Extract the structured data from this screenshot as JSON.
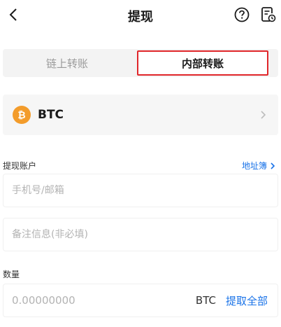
{
  "header": {
    "title": "提现",
    "back_icon": "chevron-left-icon",
    "help_icon": "question-circle-icon",
    "record_icon": "document-clock-icon"
  },
  "tabs": [
    {
      "label": "链上转账",
      "active": false
    },
    {
      "label": "内部转账",
      "active": true
    }
  ],
  "coin": {
    "name": "BTC",
    "icon": "bitcoin-icon",
    "icon_color": "#f39c2b"
  },
  "account": {
    "label": "提现账户",
    "address_book": "地址簿",
    "phone_placeholder": "手机号/邮箱",
    "remark_placeholder": "备注信息(非必填)"
  },
  "amount": {
    "label": "数量",
    "placeholder": "0.00000000",
    "unit": "BTC",
    "withdraw_all": "提取全部"
  },
  "colors": {
    "accent": "#1a73e8",
    "highlight_border": "#e0262a"
  }
}
